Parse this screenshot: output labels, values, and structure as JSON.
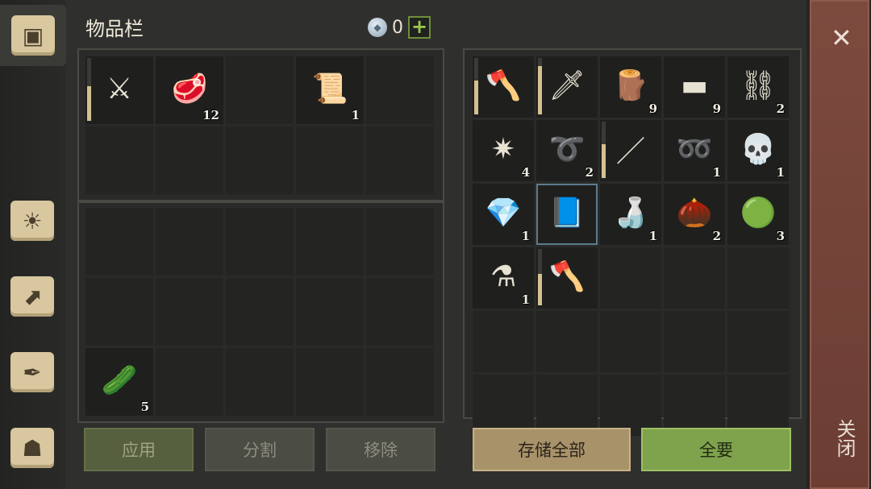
{
  "panel": {
    "title": "物品栏"
  },
  "currency": {
    "value": "0",
    "plus_label": "+"
  },
  "inventory": {
    "top_grid": [
      {
        "icon": "scimitar-icon",
        "glyph": "⚔",
        "qty": "",
        "durability": 0.55
      },
      {
        "icon": "meat-icon",
        "glyph": "🥩",
        "qty": "12"
      },
      {
        "icon": "",
        "glyph": "",
        "qty": ""
      },
      {
        "icon": "map-scroll-icon",
        "glyph": "📜",
        "qty": "1"
      },
      {
        "icon": "",
        "glyph": "",
        "qty": ""
      },
      {
        "icon": "",
        "glyph": "",
        "qty": ""
      },
      {
        "icon": "",
        "glyph": "",
        "qty": ""
      },
      {
        "icon": "",
        "glyph": "",
        "qty": ""
      },
      {
        "icon": "",
        "glyph": "",
        "qty": ""
      },
      {
        "icon": "",
        "glyph": "",
        "qty": ""
      }
    ],
    "bottom_grid": [
      {
        "icon": "",
        "glyph": "",
        "qty": ""
      },
      {
        "icon": "",
        "glyph": "",
        "qty": ""
      },
      {
        "icon": "",
        "glyph": "",
        "qty": ""
      },
      {
        "icon": "",
        "glyph": "",
        "qty": ""
      },
      {
        "icon": "",
        "glyph": "",
        "qty": ""
      },
      {
        "icon": "",
        "glyph": "",
        "qty": ""
      },
      {
        "icon": "",
        "glyph": "",
        "qty": ""
      },
      {
        "icon": "",
        "glyph": "",
        "qty": ""
      },
      {
        "icon": "",
        "glyph": "",
        "qty": ""
      },
      {
        "icon": "",
        "glyph": "",
        "qty": ""
      },
      {
        "icon": "cactus-slices-icon",
        "glyph": "🥒",
        "qty": "5"
      },
      {
        "icon": "",
        "glyph": "",
        "qty": ""
      },
      {
        "icon": "",
        "glyph": "",
        "qty": ""
      },
      {
        "icon": "",
        "glyph": "",
        "qty": ""
      },
      {
        "icon": "",
        "glyph": "",
        "qty": ""
      }
    ]
  },
  "storage": {
    "grid": [
      {
        "icon": "halberd-icon",
        "glyph": "🪓",
        "qty": "",
        "durability": 0.6
      },
      {
        "icon": "sword-icon",
        "glyph": "🗡",
        "qty": "",
        "durability": 0.85
      },
      {
        "icon": "wood-plank-icon",
        "glyph": "🪵",
        "qty": "9"
      },
      {
        "icon": "copper-ingot-icon",
        "glyph": "▬",
        "qty": "9"
      },
      {
        "icon": "chain-icon",
        "glyph": "⛓",
        "qty": "2"
      },
      {
        "icon": "scrap-icon",
        "glyph": "✷",
        "qty": "4"
      },
      {
        "icon": "rope-icon",
        "glyph": "➰",
        "qty": "2"
      },
      {
        "icon": "spear-icon",
        "glyph": "／",
        "qty": "",
        "durability": 0.6
      },
      {
        "icon": "leather-strip-icon",
        "glyph": "➿",
        "qty": "1"
      },
      {
        "icon": "skull-icon",
        "glyph": "💀",
        "qty": "1"
      },
      {
        "icon": "crystal-icon",
        "glyph": "💎",
        "qty": "1"
      },
      {
        "icon": "spellbook-icon",
        "glyph": "📘",
        "qty": "",
        "highlight": true
      },
      {
        "icon": "bottle-icon",
        "glyph": "🍶",
        "qty": "1"
      },
      {
        "icon": "seeds-icon",
        "glyph": "🌰",
        "qty": "2"
      },
      {
        "icon": "herb-ball-icon",
        "glyph": "🟢",
        "qty": "3"
      },
      {
        "icon": "potion-flask-icon",
        "glyph": "⚗",
        "qty": "1"
      },
      {
        "icon": "halberd-icon",
        "glyph": "🪓",
        "qty": "",
        "durability": 0.55
      },
      {
        "icon": "",
        "glyph": "",
        "qty": ""
      },
      {
        "icon": "",
        "glyph": "",
        "qty": ""
      },
      {
        "icon": "",
        "glyph": "",
        "qty": ""
      },
      {
        "icon": "",
        "glyph": "",
        "qty": ""
      },
      {
        "icon": "",
        "glyph": "",
        "qty": ""
      },
      {
        "icon": "",
        "glyph": "",
        "qty": ""
      },
      {
        "icon": "",
        "glyph": "",
        "qty": ""
      },
      {
        "icon": "",
        "glyph": "",
        "qty": ""
      },
      {
        "icon": "",
        "glyph": "",
        "qty": ""
      },
      {
        "icon": "",
        "glyph": "",
        "qty": ""
      },
      {
        "icon": "",
        "glyph": "",
        "qty": ""
      },
      {
        "icon": "",
        "glyph": "",
        "qty": ""
      },
      {
        "icon": "",
        "glyph": "",
        "qty": ""
      }
    ]
  },
  "buttons": {
    "apply": "应用",
    "split": "分割",
    "remove": "移除",
    "store_all": "存储全部",
    "take_all": "全要"
  },
  "close": {
    "label": "关闭",
    "x": "✕"
  },
  "sidebar_tabs": [
    {
      "icon": "chest-icon",
      "glyph": "▣"
    },
    {
      "icon": "sun-book-icon",
      "glyph": "☀"
    },
    {
      "icon": "crafting-arrow-icon",
      "glyph": "⬈"
    },
    {
      "icon": "quest-scroll-icon",
      "glyph": "✒"
    },
    {
      "icon": "character-icon",
      "glyph": "☗"
    }
  ]
}
